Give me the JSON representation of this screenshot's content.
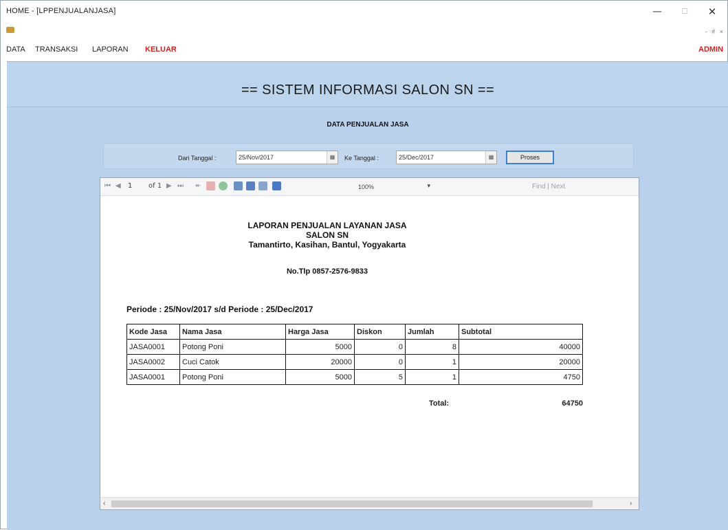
{
  "window": {
    "title": "HOME - [LPPENJUALANJASA]",
    "min_icon": "minimize-icon",
    "max_icon": "maximize-icon",
    "close_icon": "close-icon",
    "min_glyph": "—",
    "max_glyph": "☐",
    "close_glyph": "✕",
    "mdi_controls": "- # ×"
  },
  "menu": {
    "items": [
      "DATA",
      "TRANSAKSI",
      "LAPORAN",
      "KELUAR"
    ],
    "user": "ADMIN",
    "accent_color": "#d21f1f"
  },
  "header": {
    "title": "== SISTEM INFORMASI SALON SN ==",
    "subtitle": "DATA PENJUALAN JASA"
  },
  "filter": {
    "from_label": "Dari Tanggal :",
    "from_value": "25/Nov/2017",
    "to_label": "Ke Tanggal :",
    "to_value": "25/Dec/2017",
    "process_label": "Proses"
  },
  "report_toolbar": {
    "first": "⏮",
    "prev": "◀",
    "page": "1",
    "of_pages": "of 1",
    "next": "▶",
    "last": "⏭",
    "zoom": "100%",
    "zoom_arrow": "▾",
    "find": "Find",
    "separator": "|",
    "next_find": "Next",
    "icons": [
      "stop-icon",
      "refresh-icon",
      "back-icon",
      "print-icon",
      "layout-icon",
      "page-setup-icon",
      "export-icon"
    ]
  },
  "report": {
    "heading_line1": "LAPORAN PENJUALAN LAYANAN JASA",
    "heading_line2": "SALON SN",
    "heading_line3": "Tamantirto, Kasihan, Bantul, Yogyakarta",
    "phone": "No.Tlp 0857-2576-9833",
    "periode": "Periode :  25/Nov/2017 s/d Periode : 25/Dec/2017",
    "columns": [
      "Kode Jasa",
      "Nama Jasa",
      "Harga Jasa",
      "Diskon",
      "Jumlah",
      "Subtotal"
    ],
    "rows": [
      [
        "JASA0001",
        "Potong Poni",
        "5000",
        "0",
        "8",
        "40000"
      ],
      [
        "JASA0002",
        "Cuci Catok",
        "20000",
        "0",
        "1",
        "20000"
      ],
      [
        "JASA0001",
        "Potong Poni",
        "5000",
        "5",
        "1",
        "4750"
      ]
    ],
    "total_label": "Total:",
    "total_value": "64750"
  },
  "scrollbar": {
    "left": "‹",
    "right": "›"
  },
  "colors": {
    "client_bg": "#b9d1ea",
    "button_border": "#3c7fd2"
  }
}
